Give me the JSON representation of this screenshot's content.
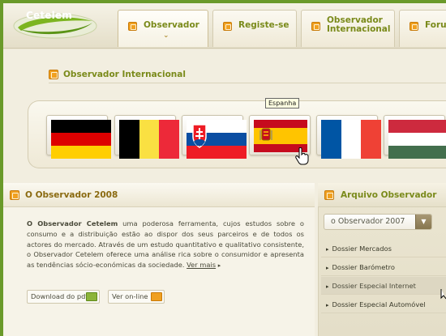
{
  "brand": {
    "logo_text": "Cetelem",
    "logo_green": "#7cb520",
    "accent_orange": "#f0a020",
    "title_green": "#7a8a1a"
  },
  "nav": {
    "tabs": [
      {
        "label": "Observador",
        "icon": "document-icon",
        "active": true
      },
      {
        "label": "Registe-se",
        "icon": "document-icon"
      },
      {
        "label_line1": "Observador",
        "label_line2": "Internacional",
        "icon": "grid-icon"
      },
      {
        "label": "Foru",
        "icon": "document-icon"
      }
    ]
  },
  "intl": {
    "title": "Observador Internacional",
    "tooltip": "Espanha",
    "flags": [
      {
        "country": "Germany",
        "icon": "flag-germany-icon"
      },
      {
        "country": "Belgium",
        "icon": "flag-belgium-icon"
      },
      {
        "country": "Slovakia",
        "icon": "flag-slovakia-icon"
      },
      {
        "country": "Espanha",
        "icon": "flag-spain-icon",
        "hovered": true
      },
      {
        "country": "France",
        "icon": "flag-france-icon"
      },
      {
        "country": "Hungary",
        "icon": "flag-hungary-icon"
      }
    ]
  },
  "observador": {
    "title": "O Observador 2008",
    "intro_bold": "O Observador Cetelem",
    "text": " uma poderosa ferramenta, cujos estudos sobre o consumo e a distribuição estão ao dispor dos seus parceiros e de todos os actores do mercado. Através de um estudo quantitativo e qualitativo consistente, o Observador Cetelem oferece uma análise rica sobre o consumidor e apresenta as tendências sócio-económicas da sociedade.",
    "more_link": "Ver mais",
    "download_button": "Download do pdf",
    "online_button": "Ver on-line"
  },
  "arquivo": {
    "title": "Arquivo Observador",
    "selected": "o Observador 2007",
    "items": [
      "Dossier Mercados",
      "Dossier Barómetro",
      "Dossier Especial Internet",
      "Dossier Especial Automóvel"
    ]
  }
}
